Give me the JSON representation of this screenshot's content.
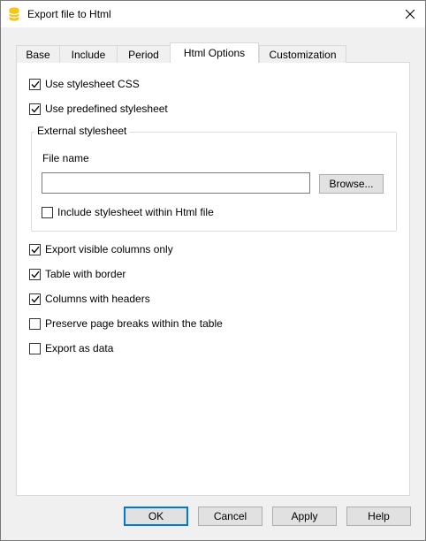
{
  "window": {
    "title": "Export file to Html"
  },
  "tabs": [
    {
      "label": "Base"
    },
    {
      "label": "Include"
    },
    {
      "label": "Period"
    },
    {
      "label": "Html Options",
      "active": true
    },
    {
      "label": "Customization"
    }
  ],
  "options_top": [
    {
      "label": "Use stylesheet CSS",
      "checked": true
    },
    {
      "label": "Use predefined stylesheet",
      "checked": true
    }
  ],
  "external": {
    "group_title": "External stylesheet",
    "file_label": "File name",
    "file_value": "",
    "browse_label": "Browse...",
    "include_label": "Include stylesheet within Html file",
    "include_checked": false
  },
  "options_bottom": [
    {
      "label": "Export visible columns only",
      "checked": true
    },
    {
      "label": "Table with border",
      "checked": true
    },
    {
      "label": "Columns with headers",
      "checked": true
    },
    {
      "label": "Preserve page breaks within the table",
      "checked": false
    },
    {
      "label": "Export as data",
      "checked": false
    }
  ],
  "buttons": {
    "ok": "OK",
    "cancel": "Cancel",
    "apply": "Apply",
    "help": "Help"
  },
  "colors": {
    "accent": "#0078d7",
    "app_icon": "#f5c518"
  }
}
